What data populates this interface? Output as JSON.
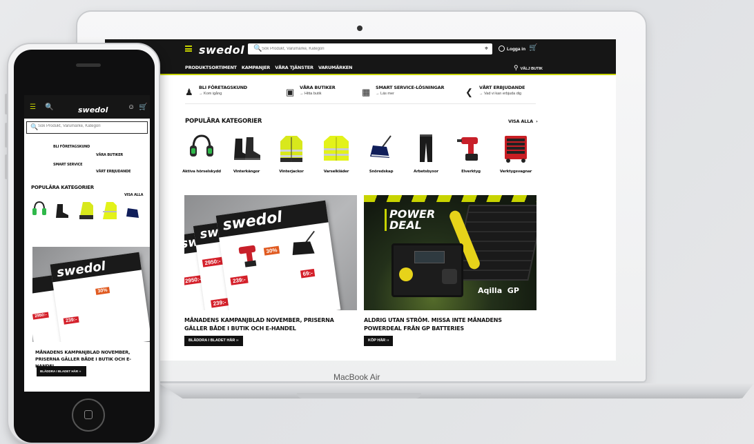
{
  "laptop": {
    "brand": "MacBook Air"
  },
  "site": {
    "logo": "swedol",
    "search_placeholder": "Sök Produkt, Varumärke, Kategori",
    "login_label": "Logga in",
    "nav_items": [
      "PRODUKTSORTIMENT",
      "KAMPANJER",
      "VÅRA TJÄNSTER",
      "VARUMÄRKEN"
    ],
    "store_label": "VÄLJ BUTIK",
    "accent_color": "#c8d400",
    "services": [
      {
        "title": "BLI FÖRETAGSKUND",
        "sub": "→ Kom igång",
        "icon": "business-user-icon"
      },
      {
        "title": "VÅRA BUTIKER",
        "sub": "→ Hitta butik",
        "icon": "store-icon"
      },
      {
        "title": "SMART SERVICE-LÖSNINGAR",
        "sub": "→ Läs mer",
        "icon": "service-icon"
      },
      {
        "title": "VÅRT ERBJUDANDE",
        "sub": "→ Vad vi kan erbjuda dig",
        "icon": "megaphone-icon"
      }
    ],
    "popular_title": "POPULÄRA KATEGORIER",
    "see_all": "VISA ALLA",
    "categories": [
      "Aktiva hörselskydd",
      "Vinterkängor",
      "Vinterjackor",
      "Varselkläder",
      "Snöredskap",
      "Arbetsbyxor",
      "Elverktyg",
      "Verktygsvagnar"
    ],
    "promos": [
      {
        "caption": "MÅNADENS KAMPANJBLAD NOVEMBER, PRISERNA GÄLLER BÅDE I BUTIK OCH E-HANDEL",
        "button": "BLÄDDRA I BLADET HÄR ››",
        "image_logo": "swedol",
        "prices": [
          "2950:-",
          "2950:-",
          "239:-",
          "239:-",
          "69:-",
          "30%"
        ]
      },
      {
        "caption": "ALDRIG UTAN STRÖM. MISSA INTE MÅNADENS POWERDEAL FRÅN GP BATTERIES",
        "button": "KÖP HÄR ››",
        "image_title": [
          "POWER",
          "DEAL"
        ],
        "image_brands": [
          "Aqilla",
          "GP"
        ]
      }
    ]
  },
  "phone": {
    "logo": "swedol",
    "search_placeholder": "Sök Produkt, Varumärke, Kategori",
    "popular_title": "POPULÄRA KATEGORIER",
    "see_all": "VISA ALLA",
    "promo_caption": "MÅNADENS KAMPANJBLAD NOVEMBER, PRISERNA GÄLLER BÅDE I BUTIK OCH E-HANDEL",
    "promo_button": "BLÄDDRA I BLADET HÄR ››",
    "services": [
      "BLI FÖRETAGSKUND",
      "VÅRA BUTIKER",
      "SMART SERVICE",
      "VÅRT ERBJUDANDE"
    ]
  }
}
